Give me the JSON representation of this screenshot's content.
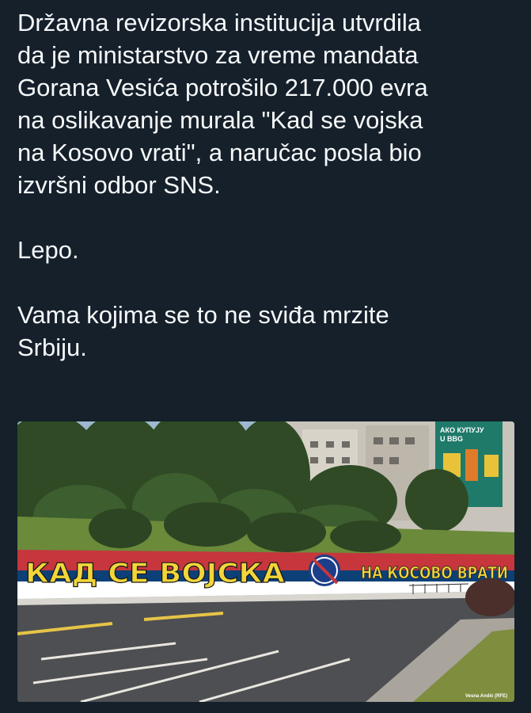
{
  "post": {
    "paragraphs": [
      "Državna revizorska institucija utvrdila\nda je ministarstvo za vreme mandata\nGorana Vesića potrošilo 217.000 evra\nna oslikavanje murala \"Kad se vojska\nna Kosovo vrati\", a naručac posla bio\nizvršni odbor SNS.",
      "Lepo.",
      "Vama kojima se to ne sviđa mrzite\nSrbiju."
    ]
  },
  "photo": {
    "mural_text_left": "КАД СЕ ВОЈСКА",
    "mural_text_right": "НА КОСОВО ВРАТИ",
    "billboard_text": "АКО КУПУЈУ\nU BBG",
    "credit": "Vesna Andić (RFE)"
  },
  "colors": {
    "background": "#15202b",
    "text": "#f7f9f9",
    "flag_red": "#c6363c",
    "flag_blue": "#0c4076",
    "flag_white": "#ffffff",
    "mural_letters": "#f2d63a"
  }
}
